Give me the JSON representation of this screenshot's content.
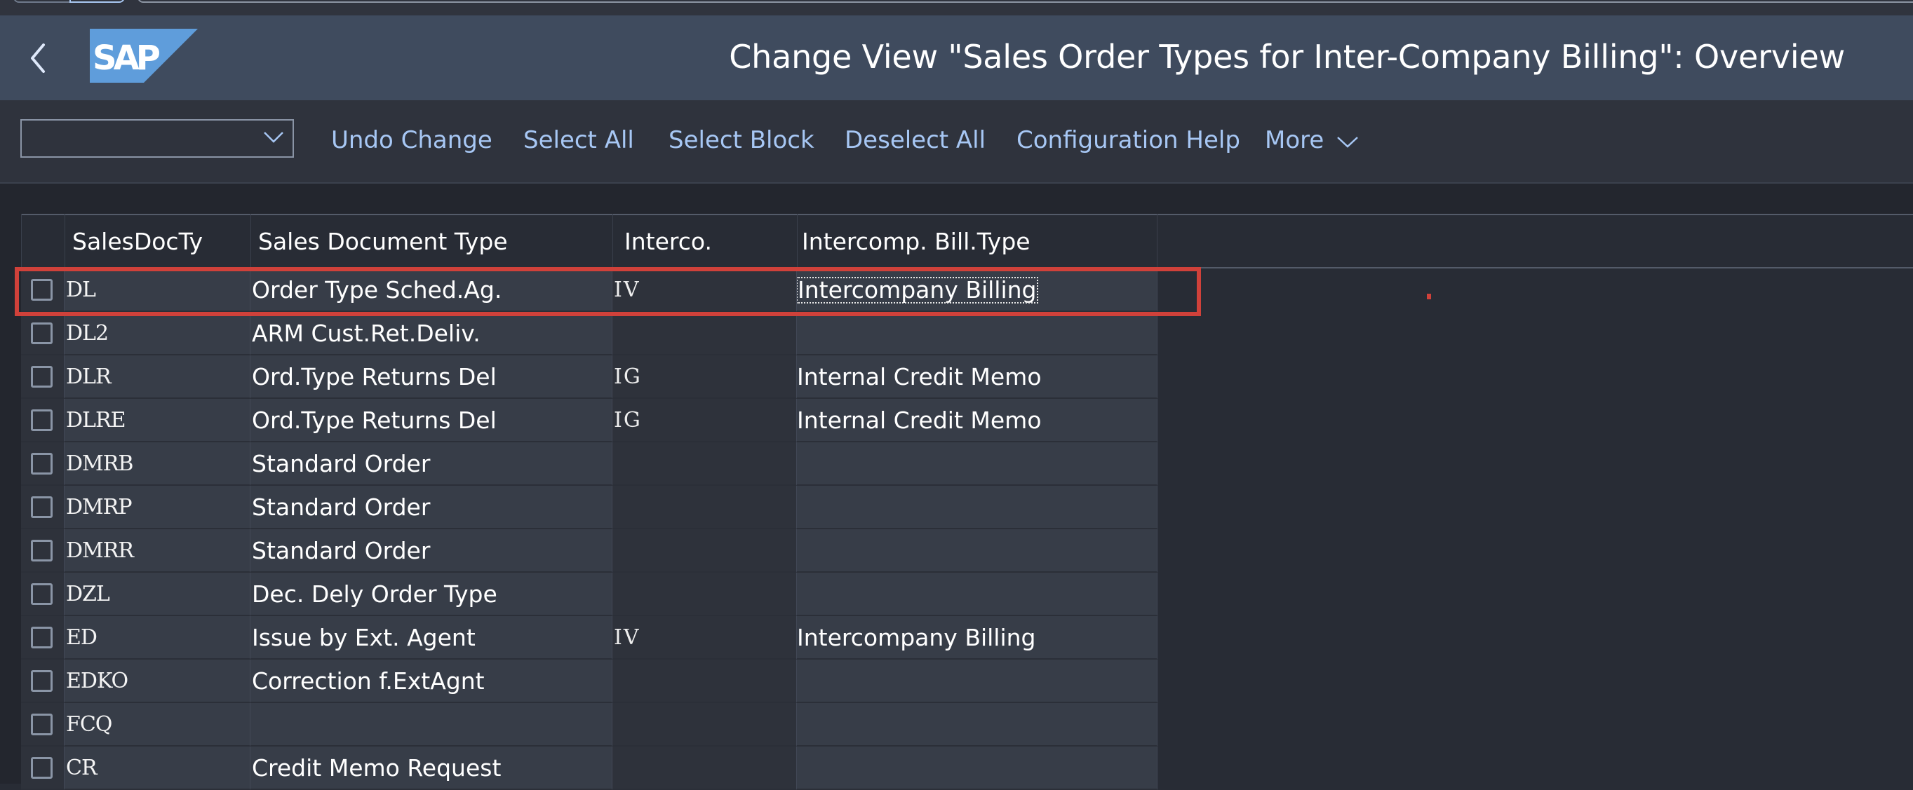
{
  "shell": {
    "title": "Change View \"Sales Order Types for Inter-Company Billing\": Overview",
    "logo_text": "SAP",
    "back_icon": "chevron-left-icon",
    "logo_color": "#5f9ddb"
  },
  "toolbar": {
    "select_value": "",
    "buttons": [
      {
        "label": "Undo Change"
      },
      {
        "label": "Select All"
      },
      {
        "label": "Select Block"
      },
      {
        "label": "Deselect All"
      },
      {
        "label": "Configuration Help"
      },
      {
        "label": "More",
        "icon": "chevron-down-icon"
      }
    ],
    "link_color": "#a7c7f4"
  },
  "table": {
    "columns": [
      "SalesDocTy",
      "Sales Document Type",
      "Interco.",
      "Intercomp. Bill.Type"
    ],
    "rows": [
      {
        "code": "DL",
        "description": "Order Type Sched.Ag.",
        "interco": "IV",
        "bill_type": "Intercompany Billing",
        "highlighted": true,
        "focused": true
      },
      {
        "code": "DL2",
        "description": "ARM Cust.Ret.Deliv.",
        "interco": "",
        "bill_type": ""
      },
      {
        "code": "DLR",
        "description": "Ord.Type Returns Del",
        "interco": "IG",
        "bill_type": "Internal Credit Memo"
      },
      {
        "code": "DLRE",
        "description": "Ord.Type Returns Del",
        "interco": "IG",
        "bill_type": "Internal Credit Memo"
      },
      {
        "code": "DMRB",
        "description": "Standard Order",
        "interco": "",
        "bill_type": ""
      },
      {
        "code": "DMRP",
        "description": "Standard Order",
        "interco": "",
        "bill_type": ""
      },
      {
        "code": "DMRR",
        "description": "Standard Order",
        "interco": "",
        "bill_type": ""
      },
      {
        "code": "DZL",
        "description": "Dec. Dely Order Type",
        "interco": "",
        "bill_type": ""
      },
      {
        "code": "ED",
        "description": "Issue by Ext. Agent",
        "interco": "IV",
        "bill_type": "Intercompany Billing"
      },
      {
        "code": "EDKO",
        "description": "Correction f.ExtAgnt",
        "interco": "",
        "bill_type": ""
      },
      {
        "code": "FCQ",
        "description": "",
        "interco": "",
        "bill_type": ""
      },
      {
        "code": "CR",
        "description": "Credit Memo Request",
        "interco": "",
        "bill_type": ""
      }
    ],
    "highlight_color": "#d0413a"
  }
}
